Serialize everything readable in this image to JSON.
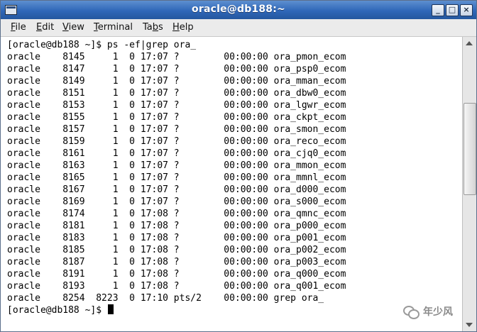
{
  "window": {
    "title": "oracle@db188:~"
  },
  "menu": [
    "File",
    "Edit",
    "View",
    "Terminal",
    "Tabs",
    "Help"
  ],
  "terminal": {
    "lines": [
      "[oracle@db188 ~]$ ps -ef|grep ora_",
      "oracle    8145     1  0 17:07 ?        00:00:00 ora_pmon_ecom",
      "oracle    8147     1  0 17:07 ?        00:00:00 ora_psp0_ecom",
      "oracle    8149     1  0 17:07 ?        00:00:00 ora_mman_ecom",
      "oracle    8151     1  0 17:07 ?        00:00:00 ora_dbw0_ecom",
      "oracle    8153     1  0 17:07 ?        00:00:00 ora_lgwr_ecom",
      "oracle    8155     1  0 17:07 ?        00:00:00 ora_ckpt_ecom",
      "oracle    8157     1  0 17:07 ?        00:00:00 ora_smon_ecom",
      "oracle    8159     1  0 17:07 ?        00:00:00 ora_reco_ecom",
      "oracle    8161     1  0 17:07 ?        00:00:00 ora_cjq0_ecom",
      "oracle    8163     1  0 17:07 ?        00:00:00 ora_mmon_ecom",
      "oracle    8165     1  0 17:07 ?        00:00:00 ora_mmnl_ecom",
      "oracle    8167     1  0 17:07 ?        00:00:00 ora_d000_ecom",
      "oracle    8169     1  0 17:07 ?        00:00:00 ora_s000_ecom",
      "oracle    8174     1  0 17:08 ?        00:00:00 ora_qmnc_ecom",
      "oracle    8181     1  0 17:08 ?        00:00:00 ora_p000_ecom",
      "oracle    8183     1  0 17:08 ?        00:00:00 ora_p001_ecom",
      "oracle    8185     1  0 17:08 ?        00:00:00 ora_p002_ecom",
      "oracle    8187     1  0 17:08 ?        00:00:00 ora_p003_ecom",
      "oracle    8191     1  0 17:08 ?        00:00:00 ora_q000_ecom",
      "oracle    8193     1  0 17:08 ?        00:00:00 ora_q001_ecom",
      "oracle    8254  8223  0 17:10 pts/2    00:00:00 grep ora_",
      "[oracle@db188 ~]$ "
    ]
  },
  "watermark": {
    "text": "年少风",
    "icon": "wechat-icon"
  }
}
